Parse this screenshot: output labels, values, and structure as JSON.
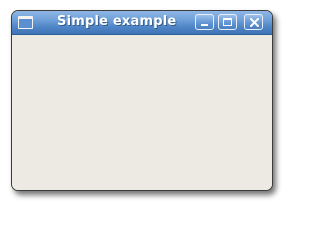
{
  "window": {
    "title": "Simple example",
    "icon": "window-icon",
    "controls": {
      "minimize_icon": "minimize-icon",
      "maximize_icon": "maximize-icon",
      "close_icon": "close-icon"
    }
  },
  "colors": {
    "titlebar": "#5b8fcf",
    "client_background": "#edeae4",
    "title_text": "#ffffff"
  }
}
